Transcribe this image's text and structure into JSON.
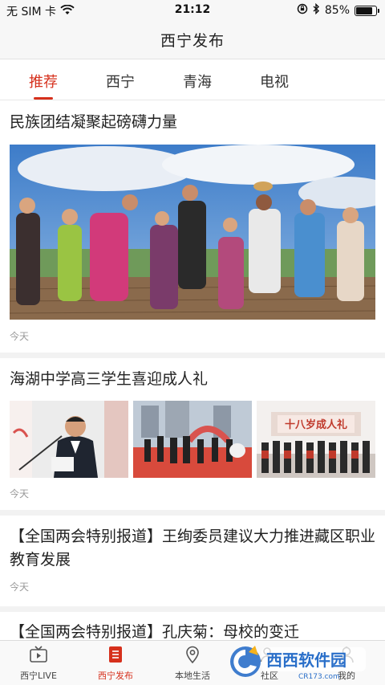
{
  "status_bar": {
    "carrier": "无 SIM 卡",
    "time": "21:12",
    "battery_percent": "85%",
    "battery_level": 0.85
  },
  "header": {
    "title": "西宁发布"
  },
  "tabs": [
    {
      "label": "推荐",
      "active": true
    },
    {
      "label": "西宁",
      "active": false
    },
    {
      "label": "青海",
      "active": false
    },
    {
      "label": "电视",
      "active": false
    }
  ],
  "articles": [
    {
      "title": "民族团结凝聚起磅礴力量",
      "time": "今天"
    },
    {
      "title": "海湖中学高三学生喜迎成人礼",
      "time": "今天",
      "banner_text": "十八岁成人礼"
    },
    {
      "title": "【全国两会特别报道】王绚委员建议大力推进藏区职业教育发展",
      "time": "今天"
    },
    {
      "title": "【全国两会特别报道】孔庆菊：母校的变迁"
    }
  ],
  "bottom_tabs": [
    {
      "label": "西宁LIVE",
      "icon": "tv-icon",
      "active": false
    },
    {
      "label": "西宁发布",
      "icon": "document-icon",
      "active": true
    },
    {
      "label": "本地生活",
      "icon": "location-pin-icon",
      "active": false
    },
    {
      "label": "社区",
      "icon": "community-icon",
      "active": false
    },
    {
      "label": "我的",
      "icon": "profile-icon",
      "active": false
    }
  ],
  "watermark": {
    "brand": "西西软件园",
    "site": "CR173.com"
  },
  "colors": {
    "accent": "#d6301c",
    "divider": "#f2f2f2"
  }
}
